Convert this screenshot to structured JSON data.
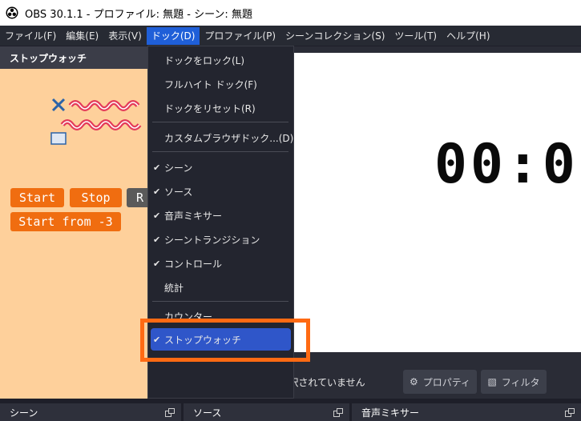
{
  "window": {
    "title": "OBS 30.1.1 - プロファイル: 無題 - シーン: 無題"
  },
  "menubar": {
    "items": [
      "ファイル(F)",
      "編集(E)",
      "表示(V)",
      "ドック(D)",
      "プロファイル(P)",
      "シーンコレクション(S)",
      "ツール(T)",
      "ヘルプ(H)"
    ],
    "active": "ドック(D)"
  },
  "stopwatch_dock": {
    "title": "ストップウォッチ",
    "buttons": {
      "start": "Start",
      "stop": "Stop",
      "reset": "R",
      "start_from": "Start from -3"
    }
  },
  "preview": {
    "timer_text": "00:0"
  },
  "controls": {
    "no_source": "ソースが選択されていません",
    "properties": "プロパティ",
    "filters": "フィルタ"
  },
  "bottom_panels": {
    "scenes": "シーン",
    "sources": "ソース",
    "audio_mixer": "音声ミキサー"
  },
  "dock_menu": {
    "lock": "ドックをロック(L)",
    "full_height": "フルハイト ドック(F)",
    "reset": "ドックをリセット(R)",
    "custom_browser": "カスタムブラウザドック...(D)",
    "scenes": "シーン",
    "sources": "ソース",
    "audio_mixer": "音声ミキサー",
    "scene_transitions": "シーントランジション",
    "controls": "コントロール",
    "stats": "統計",
    "counter": "カウンター",
    "stopwatch": "ストップウォッチ"
  },
  "colors": {
    "accent": "#f06d10",
    "highlight": "#ff6a13",
    "menu_selected": "#2f56c9"
  }
}
